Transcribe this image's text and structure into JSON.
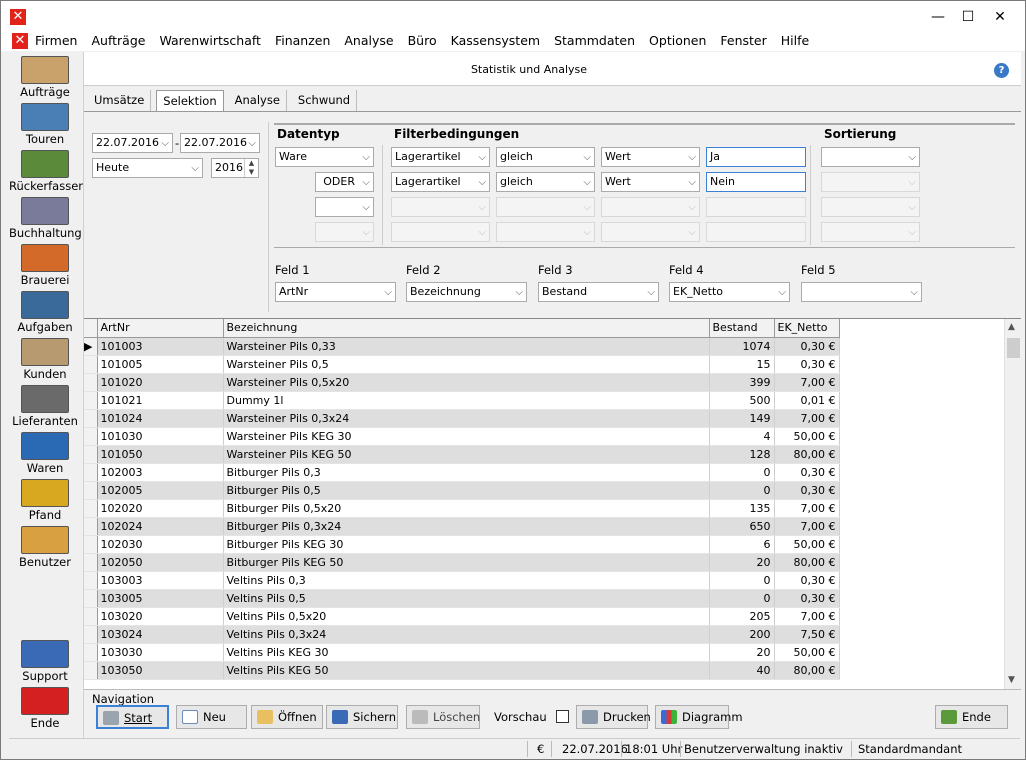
{
  "window": {
    "min": "—",
    "max": "☐",
    "close": "✕"
  },
  "menu": [
    "Firmen",
    "Aufträge",
    "Warenwirtschaft",
    "Finanzen",
    "Analyse",
    "Büro",
    "Kassensystem",
    "Stammdaten",
    "Optionen",
    "Fenster",
    "Hilfe"
  ],
  "mdi": {
    "min": "–",
    "restore": "❐",
    "close": "✕"
  },
  "sidebar": [
    {
      "label": "Aufträge",
      "color": "#c8a16b"
    },
    {
      "label": "Touren",
      "color": "#4a7fb5"
    },
    {
      "label": "Rückerfassen",
      "color": "#5a8a3a"
    },
    {
      "label": "Buchhaltung",
      "color": "#7a7a9a"
    },
    {
      "label": "Brauerei",
      "color": "#d46a2a"
    },
    {
      "label": "Aufgaben",
      "color": "#3a6a9a"
    },
    {
      "label": "Kunden",
      "color": "#b89a70"
    },
    {
      "label": "Lieferanten",
      "color": "#6a6a6a"
    },
    {
      "label": "Waren",
      "color": "#2a6ab5"
    },
    {
      "label": "Pfand",
      "color": "#d8a820"
    },
    {
      "label": "Benutzer",
      "color": "#d8a040"
    },
    {
      "label": "Support",
      "color": "#3a6ab5"
    },
    {
      "label": "Ende",
      "color": "#d42020"
    }
  ],
  "header": {
    "title": "Statistik und Analyse",
    "help": "?"
  },
  "tabs": [
    {
      "label": "Umsätze"
    },
    {
      "label": "Selektion",
      "active": true
    },
    {
      "label": "Analyse"
    },
    {
      "label": "Schwund"
    }
  ],
  "dates": {
    "from": "22.07.2016",
    "to": "22.07.2016",
    "sep": "-",
    "period": "Heute",
    "year": "2016"
  },
  "headers": {
    "datentyp": "Datentyp",
    "filter": "Filterbedingungen",
    "sort": "Sortierung"
  },
  "filters": [
    {
      "type": "Ware",
      "a": "Lagerartikel",
      "b": "gleich",
      "c": "Wert",
      "val": "Ja"
    },
    {
      "type": "ODER",
      "a": "Lagerartikel",
      "b": "gleich",
      "c": "Wert",
      "val": "Nein"
    }
  ],
  "fields": [
    {
      "label": "Feld 1",
      "value": "ArtNr"
    },
    {
      "label": "Feld 2",
      "value": "Bezeichnung"
    },
    {
      "label": "Feld 3",
      "value": "Bestand"
    },
    {
      "label": "Feld 4",
      "value": "EK_Netto"
    },
    {
      "label": "Feld 5",
      "value": ""
    }
  ],
  "table": {
    "columns": [
      "ArtNr",
      "Bezeichnung",
      "Bestand",
      "EK_Netto"
    ],
    "rows": [
      [
        "101003",
        "Warsteiner Pils 0,33",
        "1074",
        "0,30 €"
      ],
      [
        "101005",
        "Warsteiner Pils 0,5",
        "15",
        "0,30 €"
      ],
      [
        "101020",
        "Warsteiner Pils 0,5x20",
        "399",
        "7,00 €"
      ],
      [
        "101021",
        "Dummy  1l",
        "500",
        "0,01 €"
      ],
      [
        "101024",
        "Warsteiner Pils 0,3x24",
        "149",
        "7,00 €"
      ],
      [
        "101030",
        "Warsteiner Pils KEG 30",
        "4",
        "50,00 €"
      ],
      [
        "101050",
        "Warsteiner Pils KEG 50",
        "128",
        "80,00 €"
      ],
      [
        "102003",
        "Bitburger Pils 0,3",
        "0",
        "0,30 €"
      ],
      [
        "102005",
        "Bitburger Pils 0,5",
        "0",
        "0,30 €"
      ],
      [
        "102020",
        "Bitburger Pils 0,5x20",
        "135",
        "7,00 €"
      ],
      [
        "102024",
        "Bitburger Pils 0,3x24",
        "650",
        "7,00 €"
      ],
      [
        "102030",
        "Bitburger Pils KEG 30",
        "6",
        "50,00 €"
      ],
      [
        "102050",
        "Bitburger Pils KEG 50",
        "20",
        "80,00 €"
      ],
      [
        "103003",
        "Veltins Pils 0,3",
        "0",
        "0,30 €"
      ],
      [
        "103005",
        "Veltins Pils 0,5",
        "0",
        "0,30 €"
      ],
      [
        "103020",
        "Veltins Pils 0,5x20",
        "205",
        "7,00 €"
      ],
      [
        "103024",
        "Veltins Pils 0,3x24",
        "200",
        "7,50 €"
      ],
      [
        "103030",
        "Veltins Pils KEG 30",
        "20",
        "50,00 €"
      ],
      [
        "103050",
        "Veltins Pils KEG 50",
        "40",
        "80,00 €"
      ]
    ]
  },
  "nav": {
    "title": "Navigation",
    "start": "Start",
    "neu": "Neu",
    "oeffnen": "Öffnen",
    "sichern": "Sichern",
    "loeschen": "Löschen",
    "vorschau": "Vorschau",
    "drucken": "Drucken",
    "diagramm": "Diagramm",
    "ende": "Ende"
  },
  "status": {
    "currency": "€",
    "date": "22.07.2016",
    "time": "18:01 Uhr",
    "user": "Benutzerverwaltung inaktiv",
    "mandant": "Standardmandant"
  }
}
